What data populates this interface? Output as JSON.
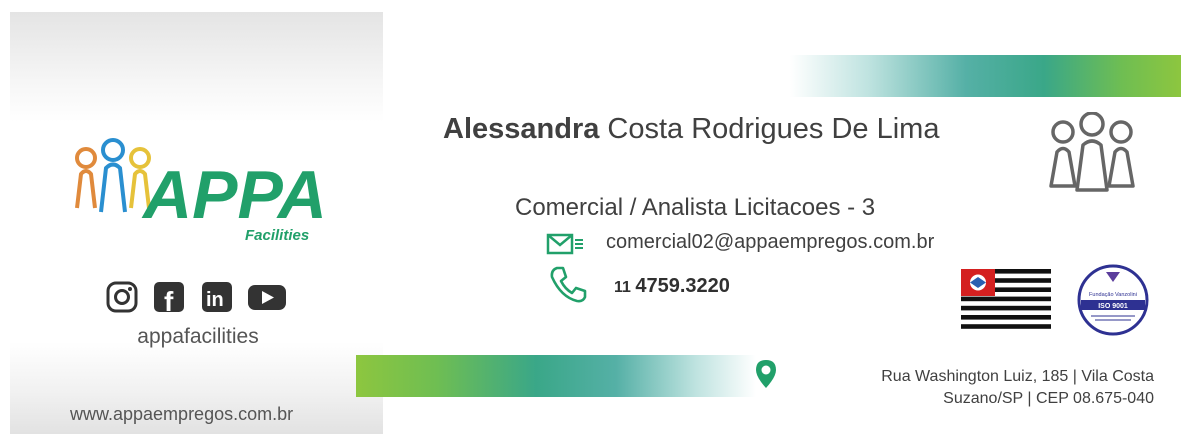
{
  "brand": {
    "logo_text": "APPA",
    "logo_subtext": "Facilities",
    "social_handle": "appafacilities",
    "website": "www.appaempregos.com.br",
    "colors": {
      "green": "#21a06a",
      "blue": "#2a8fd0",
      "orange": "#e08a3c",
      "yellow": "#e6c23a",
      "lime": "#8dc63f"
    },
    "social_icons": [
      "instagram-icon",
      "facebook-icon",
      "linkedin-icon",
      "youtube-icon"
    ],
    "social_glyphs": {
      "facebook": "f",
      "linkedin": "in"
    }
  },
  "contact": {
    "first_name": "Alessandra",
    "last_name": "Costa Rodrigues De Lima",
    "role": "Comercial / Analista Licitacoes - 3",
    "email": "comercial02@appaempregos.com.br",
    "phone_area": "11",
    "phone_number": "4759.3220",
    "address_line1": "Rua Washington Luiz, 185  |  Vila Costa",
    "address_line2": "Suzano/SP  |  CEP 08.675-040"
  },
  "badges": {
    "iso_org": "Fundação Vanzolini",
    "iso_label": "ISO 9001",
    "iso_colors": {
      "navy": "#2e3192",
      "purple": "#5b3d9c"
    }
  }
}
